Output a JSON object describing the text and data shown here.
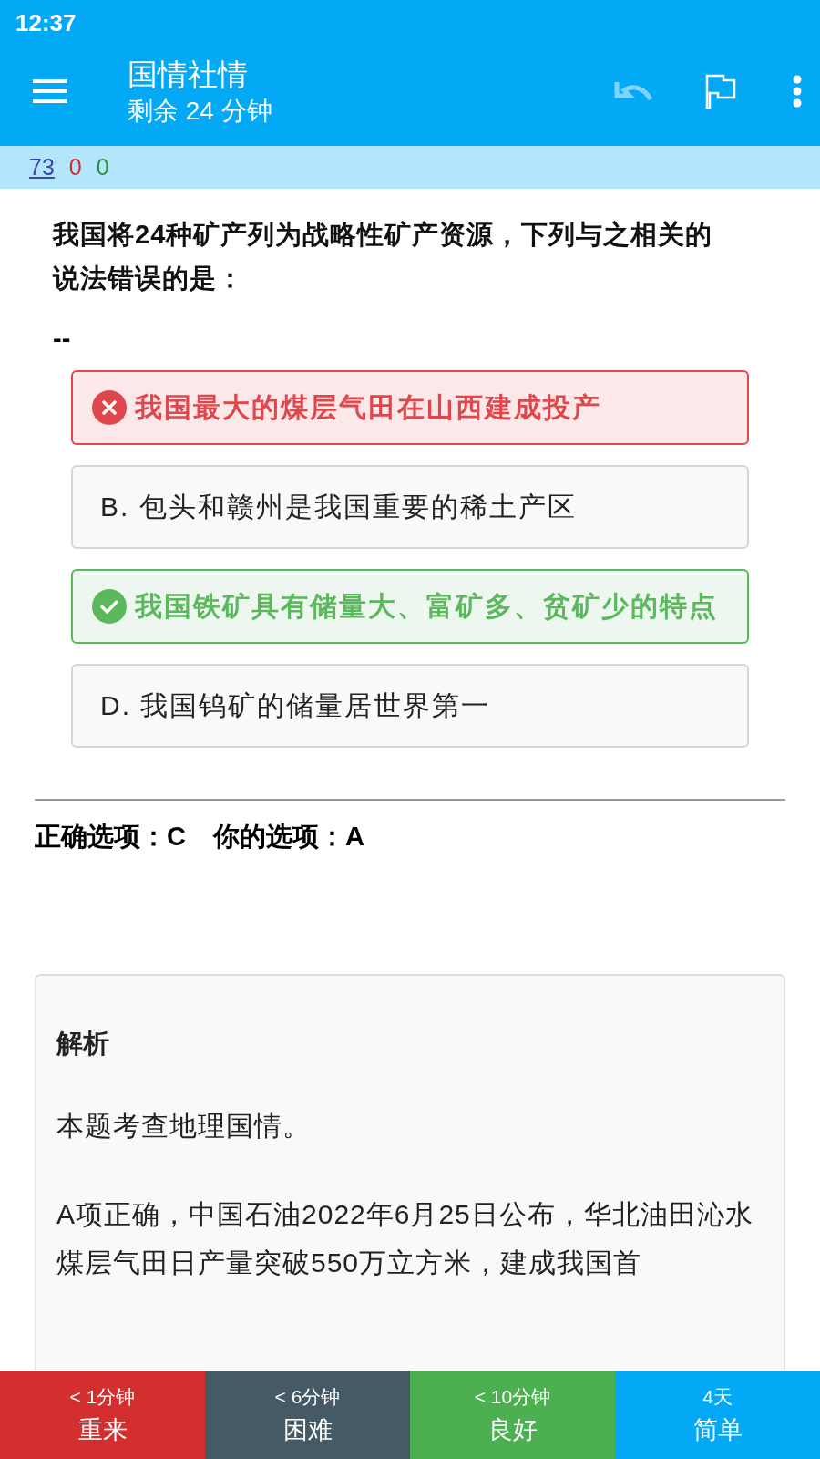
{
  "status_bar": {
    "time": "12:37"
  },
  "app_bar": {
    "title": "国情社情",
    "subtitle": "剩余 24 分钟",
    "undo_disabled": true
  },
  "stats": [
    {
      "value": "73",
      "kind": "link"
    },
    {
      "value": "0",
      "kind": "wrong"
    },
    {
      "value": "0",
      "kind": "right"
    }
  ],
  "question": {
    "text": "我国将24种矿产列为战略性矿产资源，下列与之相关的说法错误的是：",
    "separator": "--"
  },
  "options": [
    {
      "text": "我国最大的煤层气田在山西建成投产",
      "kind": "wrong"
    },
    {
      "text": "B. 包头和赣州是我国重要的稀土产区",
      "kind": "plain"
    },
    {
      "text": "我国铁矿具有储量大、富矿多、贫矿少的特点",
      "kind": "correct"
    },
    {
      "text": "D. 我国钨矿的储量居世界第一",
      "kind": "plain"
    }
  ],
  "answer_line": {
    "correct": "正确选项：C",
    "yours": "你的选项：A"
  },
  "explanation": {
    "heading": "解析",
    "paragraphs": [
      "本题考查地理国情。",
      "A项正确，中国石油2022年6月25日公布，华北油田沁水煤层气田日产量突破550万立方米，建成我国首"
    ]
  },
  "rating_buttons": [
    {
      "interval": "< 1分钟",
      "label": "重来",
      "color": "#d32f2f"
    },
    {
      "interval": "< 6分钟",
      "label": "困难",
      "color": "#455a64"
    },
    {
      "interval": "< 10分钟",
      "label": "良好",
      "color": "#4caf50"
    },
    {
      "interval": "4天",
      "label": "简单",
      "color": "#03a9f4"
    }
  ]
}
